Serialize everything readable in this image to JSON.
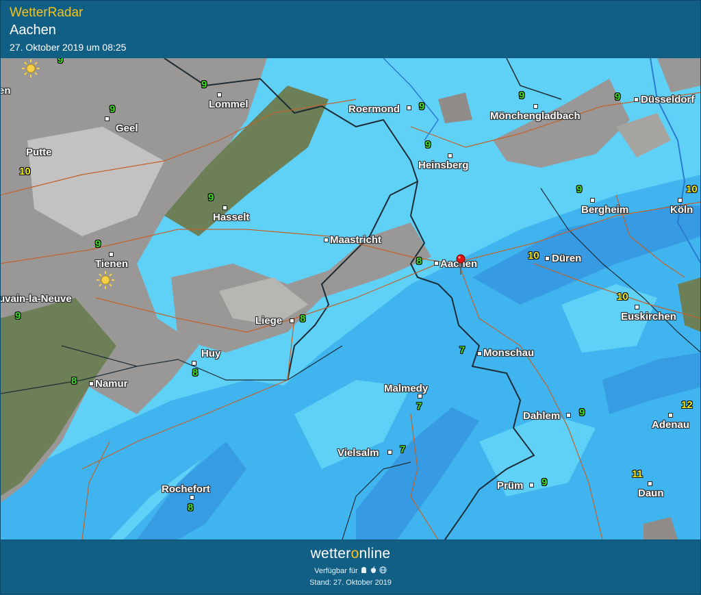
{
  "header": {
    "app_title": "WetterRadar",
    "location": "Aachen",
    "datetime": "27. Oktober 2019 um 08:25"
  },
  "cities": [
    {
      "name": "Lommel"
    },
    {
      "name": "Geel"
    },
    {
      "name": "Putte"
    },
    {
      "name": "Hasselt"
    },
    {
      "name": "Tienen"
    },
    {
      "name": "uvain-la-Neuve"
    },
    {
      "name": "Roermond"
    },
    {
      "name": "Mönchengladbach"
    },
    {
      "name": "Düsseldorf"
    },
    {
      "name": "Heinsberg"
    },
    {
      "name": "Bergheim"
    },
    {
      "name": "Köln"
    },
    {
      "name": "Maastricht"
    },
    {
      "name": "Aachen"
    },
    {
      "name": "Düren"
    },
    {
      "name": "Liege"
    },
    {
      "name": "Euskirchen"
    },
    {
      "name": "Huy"
    },
    {
      "name": "Monschau"
    },
    {
      "name": "Namur"
    },
    {
      "name": "Malmedy"
    },
    {
      "name": "Dahlem"
    },
    {
      "name": "Adenau"
    },
    {
      "name": "Vielsalm"
    },
    {
      "name": "Rochefort"
    },
    {
      "name": "Prüm"
    },
    {
      "name": "Daun"
    },
    {
      "name": "en"
    }
  ],
  "temperatures": [
    {
      "value": "9",
      "tone": "green"
    },
    {
      "value": "9",
      "tone": "green"
    },
    {
      "value": "9",
      "tone": "green"
    },
    {
      "value": "10",
      "tone": "yellow"
    },
    {
      "value": "9",
      "tone": "green"
    },
    {
      "value": "9",
      "tone": "green"
    },
    {
      "value": "9",
      "tone": "green"
    },
    {
      "value": "9",
      "tone": "green"
    },
    {
      "value": "9",
      "tone": "green"
    },
    {
      "value": "9",
      "tone": "green"
    },
    {
      "value": "9",
      "tone": "green"
    },
    {
      "value": "10",
      "tone": "yellow"
    },
    {
      "value": "9",
      "tone": "green"
    },
    {
      "value": "8",
      "tone": "green"
    },
    {
      "value": "10",
      "tone": "yellow"
    },
    {
      "value": "8",
      "tone": "green"
    },
    {
      "value": "10",
      "tone": "yellow"
    },
    {
      "value": "8",
      "tone": "green"
    },
    {
      "value": "7",
      "tone": "green"
    },
    {
      "value": "8",
      "tone": "green"
    },
    {
      "value": "7",
      "tone": "green"
    },
    {
      "value": "9",
      "tone": "green"
    },
    {
      "value": "12",
      "tone": "yellow"
    },
    {
      "value": "7",
      "tone": "green"
    },
    {
      "value": "8",
      "tone": "green"
    },
    {
      "value": "9",
      "tone": "green"
    },
    {
      "value": "11",
      "tone": "yellow"
    }
  ],
  "icons": {
    "location_pin": "location-pin-icon",
    "sun": "sun-icon",
    "android": "android-icon",
    "apple": "apple-icon",
    "web": "globe-icon"
  },
  "colors": {
    "header_bg": "#125f86",
    "app_title": "#f5c21b",
    "rain_light": "#5fd0f6",
    "rain_medium": "#3fb4ee",
    "rain_heavy": "#2f86d8",
    "dry_gray": "#8f8c8a",
    "dry_green": "#6d7f57",
    "temp_green": "#3fe024",
    "temp_yellow": "#f3ee1a"
  },
  "footer": {
    "brand_a": "wetter",
    "brand_o": "o",
    "brand_b": "nline",
    "available_label": "Verfügbar für",
    "stand": "Stand: 27. Oktober 2019"
  }
}
